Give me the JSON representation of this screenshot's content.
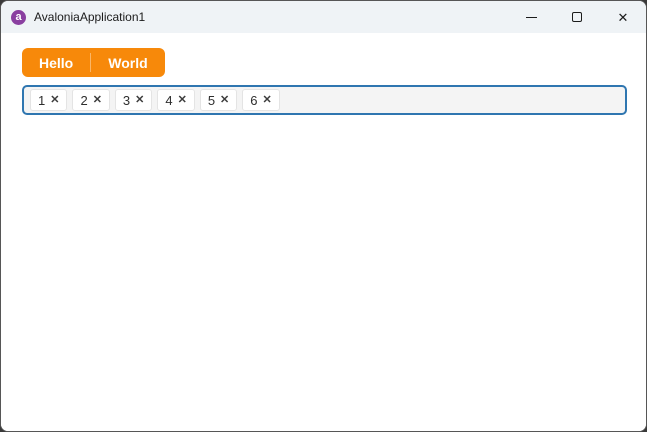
{
  "window": {
    "title": "AvaloniaApplication1",
    "app_icon_glyph": "a",
    "controls": {
      "minimize_label": "Minimize",
      "maximize_label": "Maximize",
      "close_label": "Close",
      "close_glyph": "✕"
    }
  },
  "colors": {
    "accent_orange": "#F7890A",
    "focus_border_blue": "#2F76B0",
    "titlebar_bg": "#EFF3F6",
    "desktop_bg": "#3A3A3A",
    "app_icon_purple": "#8A3FA0"
  },
  "tabs": {
    "items": [
      {
        "label": "Hello"
      },
      {
        "label": "World"
      }
    ]
  },
  "chips": {
    "remove_glyph": "✕",
    "items": [
      {
        "label": "1"
      },
      {
        "label": "2"
      },
      {
        "label": "3"
      },
      {
        "label": "4"
      },
      {
        "label": "5"
      },
      {
        "label": "6"
      }
    ]
  }
}
